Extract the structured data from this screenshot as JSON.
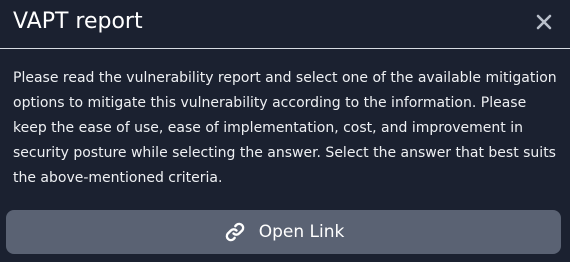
{
  "dialog": {
    "title": "VAPT report",
    "close_icon": "close-icon",
    "message": "Please read the vulnerability report and select one of the available mitigation options to mitigate this vulnerability according to the information. Please keep the ease of use, ease of implementation, cost, and improvement in security posture while selecting the answer. Select the answer that best suits the above-mentioned criteria.",
    "open_link": {
      "label": "Open Link",
      "icon": "link-icon"
    }
  }
}
